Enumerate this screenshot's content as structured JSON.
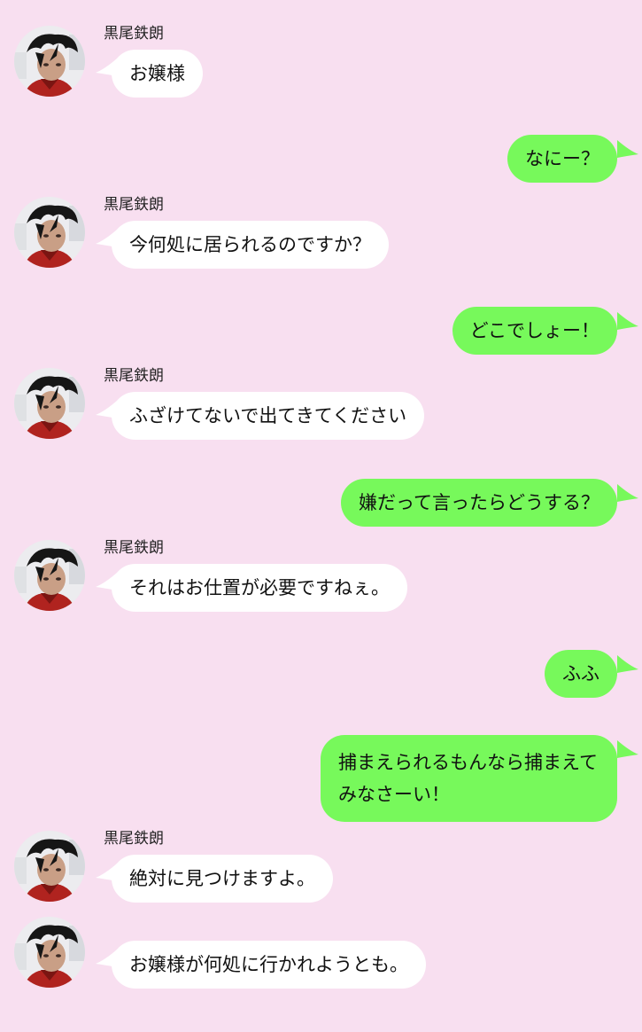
{
  "contact": {
    "name": "黒尾鉄朗"
  },
  "colors": {
    "background": "#f8dff0",
    "incoming": "#ffffff",
    "outgoing": "#77f95b"
  },
  "messages": [
    {
      "from": "contact",
      "show_name": true,
      "text": "お嬢様"
    },
    {
      "from": "me",
      "text": "なにー？"
    },
    {
      "from": "contact",
      "show_name": true,
      "text": "今何処に居られるのですか？"
    },
    {
      "from": "me",
      "text": "どこでしょー！"
    },
    {
      "from": "contact",
      "show_name": true,
      "text": "ふざけてないで出てきてください"
    },
    {
      "from": "me",
      "text": "嫌だって言ったらどうする？"
    },
    {
      "from": "contact",
      "show_name": true,
      "text": "それはお仕置が必要ですねぇ。"
    },
    {
      "from": "me",
      "text": "ふふ"
    },
    {
      "from": "me",
      "lines": [
        "捕まえられるもんなら捕まえて",
        "みなさーい！"
      ]
    },
    {
      "from": "contact",
      "show_name": true,
      "text": "絶対に見つけますよ。"
    },
    {
      "from": "contact",
      "show_name": false,
      "text": "お嬢様が何処に行かれようとも。"
    }
  ]
}
